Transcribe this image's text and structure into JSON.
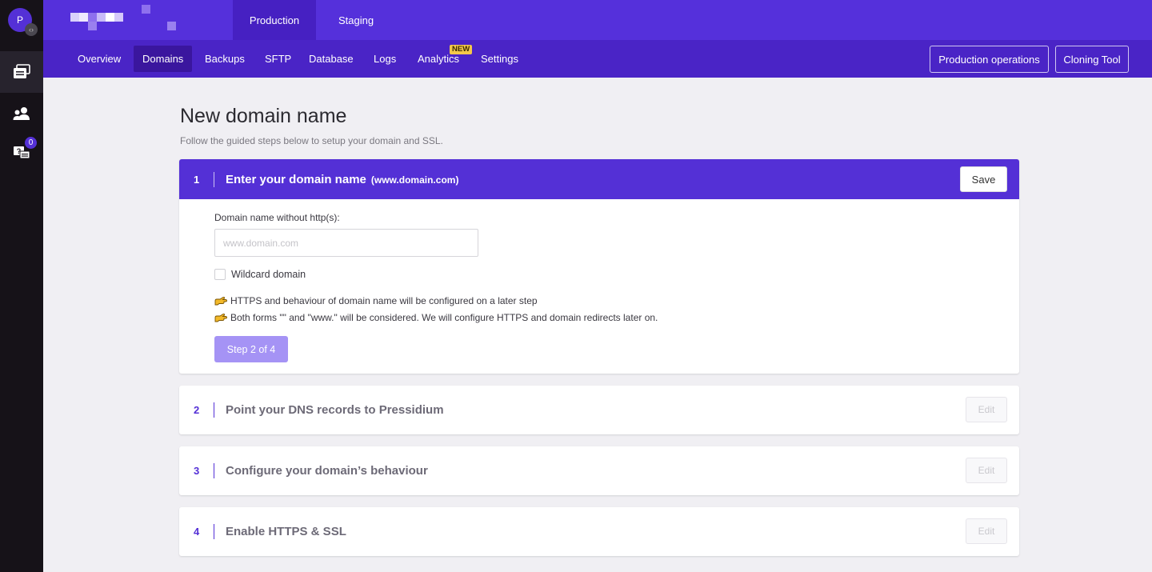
{
  "rail": {
    "avatar_initial": "P",
    "code_badge": "‹›",
    "items": [
      {
        "name": "sites",
        "icon": "stack-icon"
      },
      {
        "name": "users",
        "icon": "users-icon"
      },
      {
        "name": "support",
        "icon": "help-chat-icon",
        "badge": "0"
      }
    ]
  },
  "topbar": {
    "env_tabs": [
      {
        "label": "Production",
        "active": true
      },
      {
        "label": "Staging",
        "active": false
      }
    ]
  },
  "navbar": {
    "items": [
      {
        "label": "Overview"
      },
      {
        "label": "Domains",
        "active": true
      },
      {
        "label": "Backups"
      },
      {
        "label": "SFTP"
      },
      {
        "label": "Database"
      },
      {
        "label": "Logs"
      },
      {
        "label": "Analytics",
        "badge": "NEW"
      },
      {
        "label": "Settings"
      }
    ],
    "new_badge": "NEW",
    "buttons": {
      "production_operations": "Production operations",
      "cloning_tool": "Cloning Tool"
    }
  },
  "page": {
    "title": "New domain name",
    "subtitle": "Follow the guided steps below to setup your domain and SSL."
  },
  "steps": [
    {
      "number": "1",
      "title": "Enter your domain name",
      "hint": "(www.domain.com)",
      "action": "Save",
      "active": true,
      "body": {
        "field_label": "Domain name without http(s):",
        "input_value": "",
        "input_placeholder": "www.domain.com",
        "checkbox_label": "Wildcard domain",
        "checkbox_checked": false,
        "notes": [
          "HTTPS and behaviour of domain name will be configured on a later step",
          "Both forms \"\" and \"www.\" will be considered. We will configure HTTPS and domain redirects later on."
        ],
        "next_label": "Step 2 of 4"
      }
    },
    {
      "number": "2",
      "title": "Point your DNS records to Pressidium",
      "action": "Edit"
    },
    {
      "number": "3",
      "title": "Configure your domain’s behaviour",
      "action": "Edit"
    },
    {
      "number": "4",
      "title": "Enable HTTPS & SSL",
      "action": "Edit"
    }
  ],
  "colors": {
    "brand": "#5430d6",
    "nav": "#4a24c6",
    "nav_active": "#3a169e",
    "rail": "#161218",
    "new_badge": "#f3c74a",
    "step_next_disabled": "#a593f5"
  }
}
